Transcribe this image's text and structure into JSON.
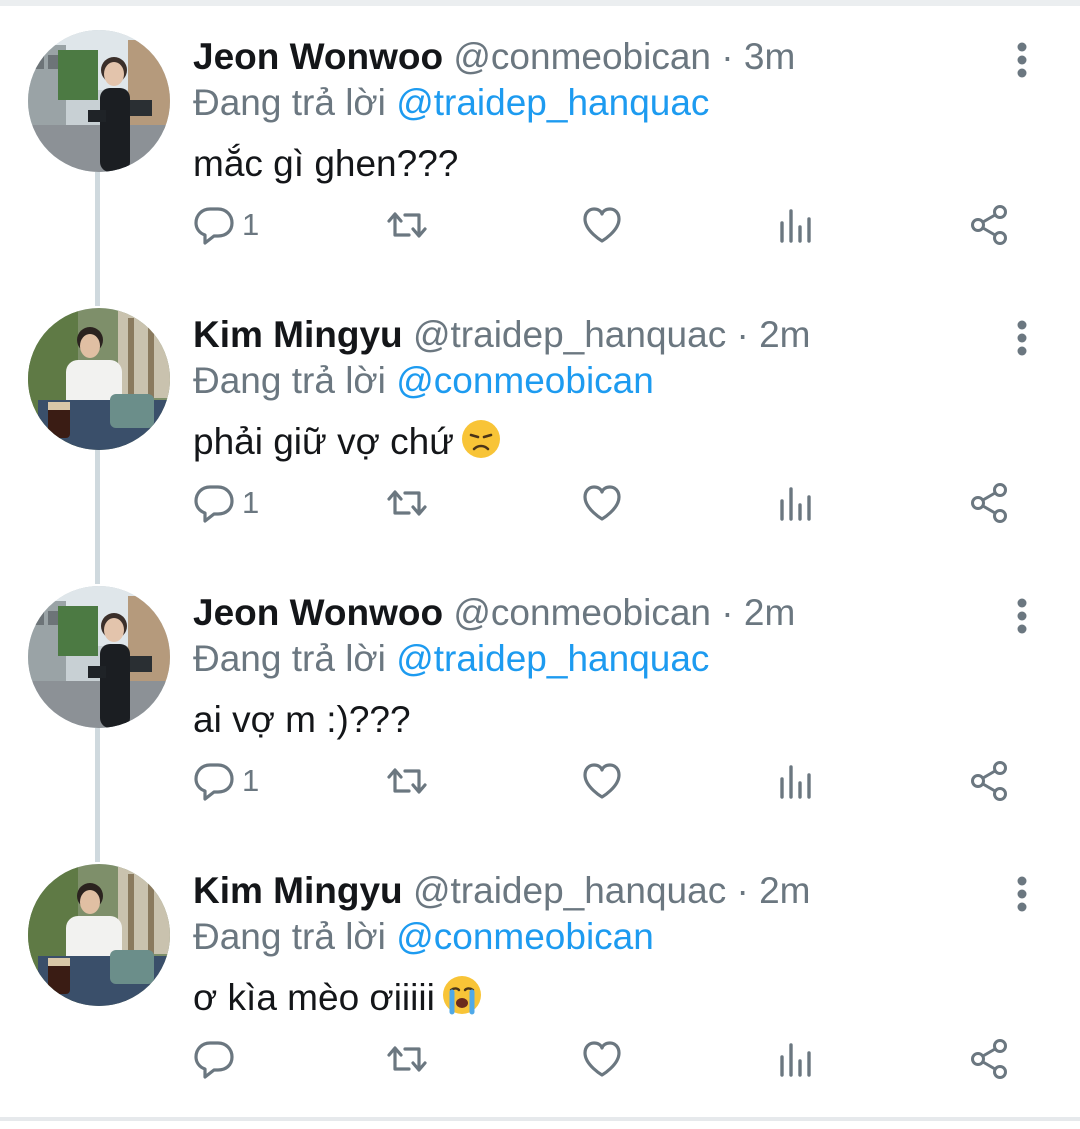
{
  "tweets": [
    {
      "name": "Jeon Wonwoo",
      "handle": "@conmeobican",
      "separator": "·",
      "time": "3m",
      "replying_prefix": "Đang trả lời",
      "replying_to": "@traidep_hanquac",
      "text": "mắc gì ghen???",
      "reply_count": "1",
      "emoji": ""
    },
    {
      "name": "Kim Mingyu",
      "handle": "@traidep_hanquac",
      "separator": "·",
      "time": "2m",
      "replying_prefix": "Đang trả lời",
      "replying_to": "@conmeobican",
      "text": "phải giữ vợ chứ",
      "reply_count": "1",
      "emoji": "disappointed-face"
    },
    {
      "name": "Jeon Wonwoo",
      "handle": "@conmeobican",
      "separator": "·",
      "time": "2m",
      "replying_prefix": "Đang trả lời",
      "replying_to": "@traidep_hanquac",
      "text": "ai vợ m :)???",
      "reply_count": "1",
      "emoji": ""
    },
    {
      "name": "Kim Mingyu",
      "handle": "@traidep_hanquac",
      "separator": "·",
      "time": "2m",
      "replying_prefix": "Đang trả lời",
      "replying_to": "@conmeobican",
      "text": "ơ kìa mèo ơiiiii",
      "reply_count": "",
      "emoji": "loudly-crying-face"
    }
  ],
  "colors": {
    "text": "#141619",
    "secondary": "#6b7780",
    "mention": "#1d9bf0",
    "thread_line": "#cfd9de"
  }
}
